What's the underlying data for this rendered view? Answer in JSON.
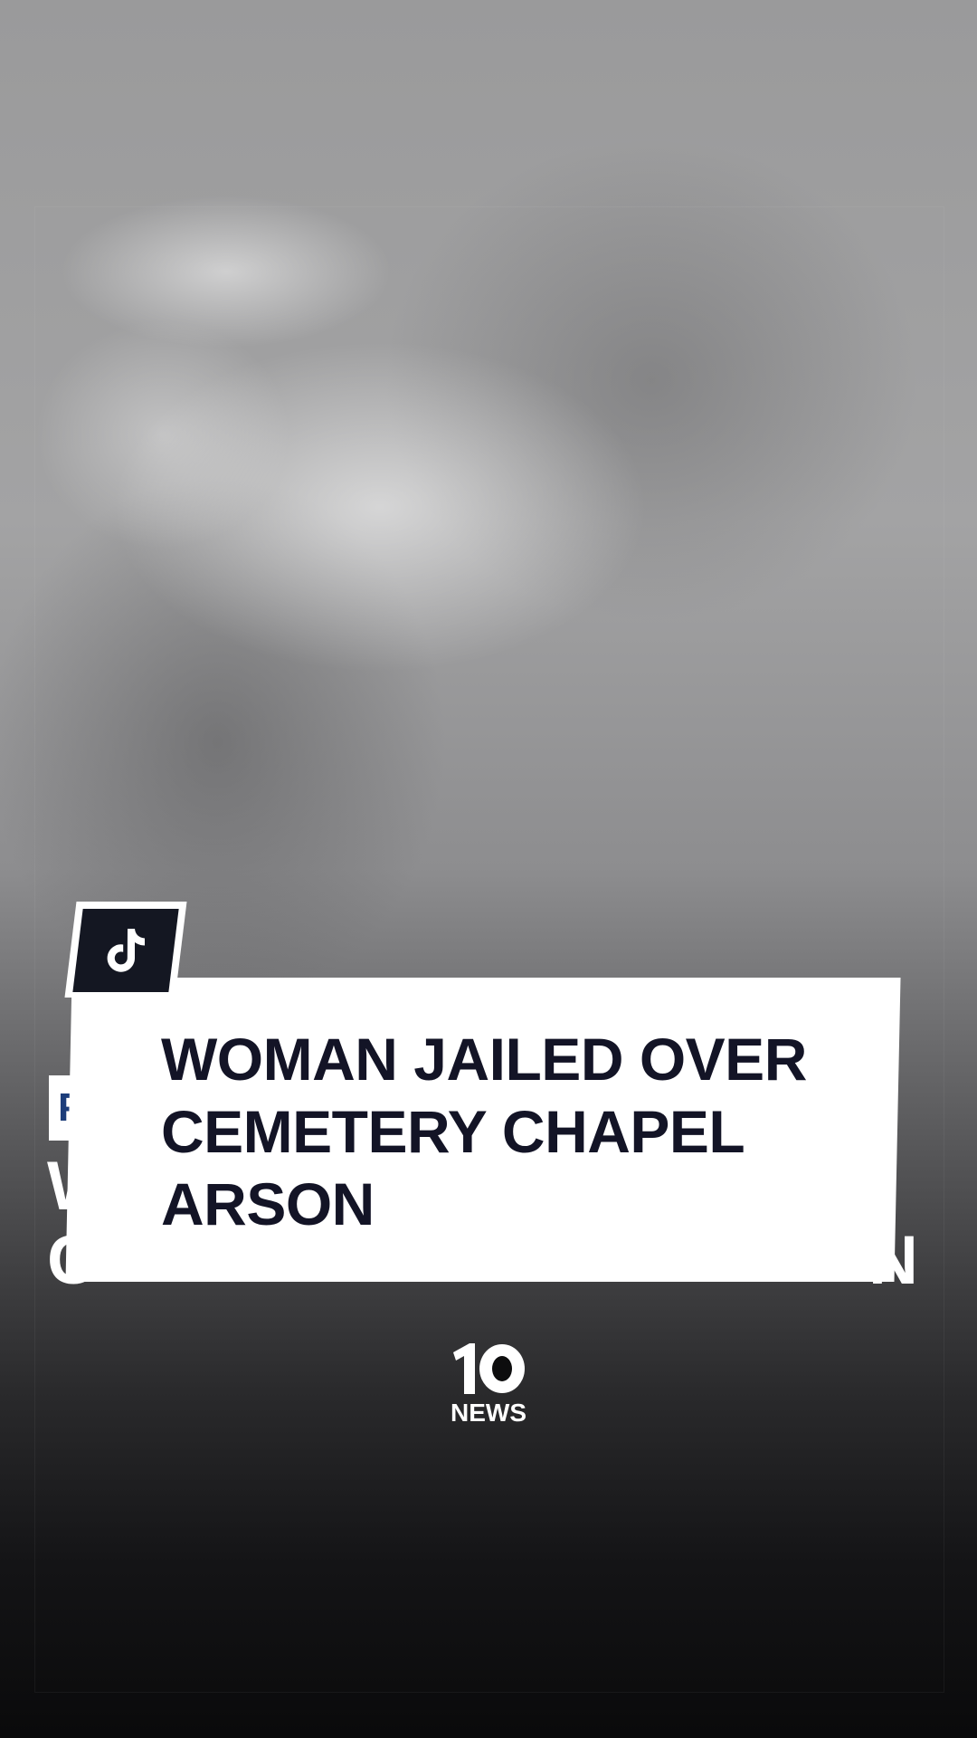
{
  "video": {
    "headline": "WOMAN JAILED OVER CEMETERY CHAPEL ARSON",
    "underlay_label_fragment": "P",
    "underlay_headline_fragment_left": "W\nC",
    "underlay_headline_fragment_right": "N"
  },
  "branding": {
    "tiktok_icon": "tiktok-icon",
    "news_logo_number": "10",
    "news_logo_text": "NEWS"
  },
  "colors": {
    "headline_text": "#131426",
    "badge_background": "#141722",
    "card_background": "#ffffff",
    "label_text": "#1c3d7a"
  }
}
